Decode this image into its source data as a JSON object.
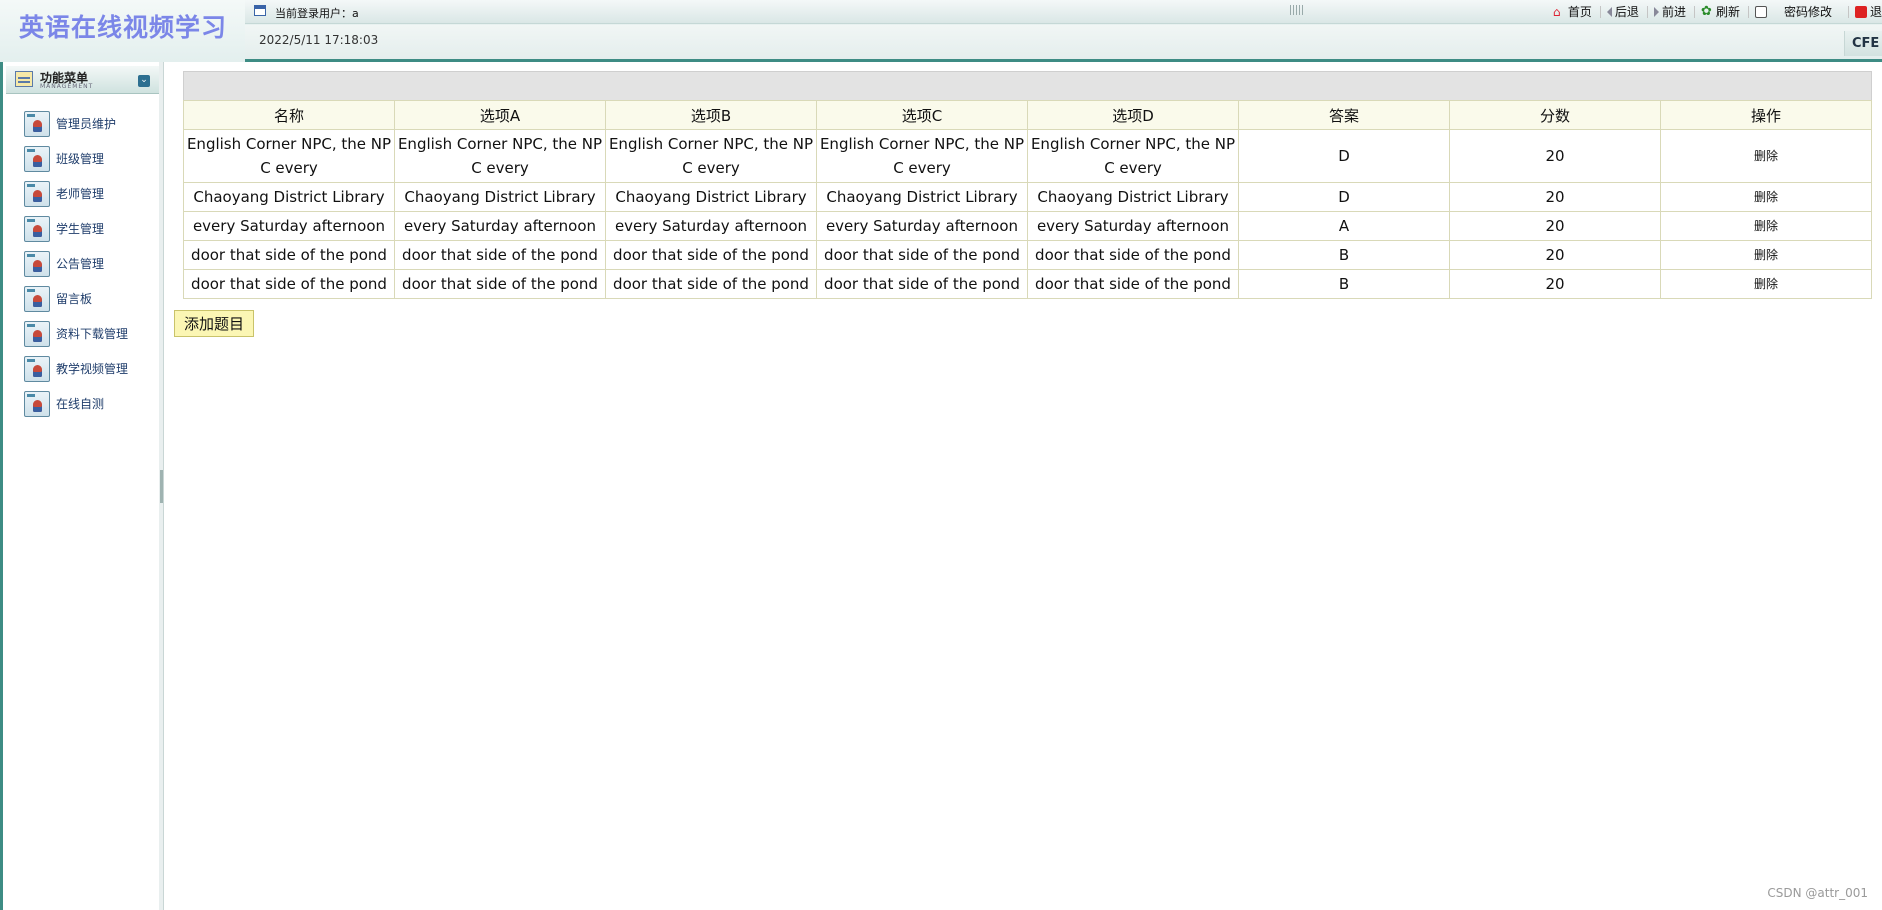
{
  "app": {
    "logo": "英语在线视频学习"
  },
  "header": {
    "current_user": "当前登录用户：a",
    "datetime": "2022/5/11 17:18:03",
    "corner_text": "CFE",
    "tools": [
      {
        "label": "首页",
        "icon": "home-icon"
      },
      {
        "label": "后退",
        "icon": "back-arrow-icon"
      },
      {
        "label": "前进",
        "icon": "forward-arrow-icon"
      },
      {
        "label": "刷新",
        "icon": "refresh-icon"
      },
      {
        "label": "密码修改",
        "icon": "edit-password-icon"
      },
      {
        "label": "退",
        "icon": "exit-icon"
      }
    ]
  },
  "sidebar": {
    "title": "功能菜单",
    "subtitle": "MANAGEMENT",
    "items": [
      {
        "label": "管理员维护",
        "icon": "user-card-icon"
      },
      {
        "label": "班级管理",
        "icon": "user-card-icon"
      },
      {
        "label": "老师管理",
        "icon": "user-card-icon"
      },
      {
        "label": "学生管理",
        "icon": "user-card-icon"
      },
      {
        "label": "公告管理",
        "icon": "user-card-icon"
      },
      {
        "label": "留言板",
        "icon": "user-card-icon"
      },
      {
        "label": "资料下载管理",
        "icon": "user-card-icon"
      },
      {
        "label": "教学视频管理",
        "icon": "user-card-icon"
      },
      {
        "label": "在线自测",
        "icon": "user-card-icon"
      }
    ]
  },
  "table": {
    "columns": [
      "名称",
      "选项A",
      "选项B",
      "选项C",
      "选项D",
      "答案",
      "分数",
      "操作"
    ],
    "rows": [
      [
        "English Corner NPC, the NPC every",
        "English Corner NPC, the NPC every",
        "English Corner NPC, the NPC every",
        "English Corner NPC, the NPC every",
        "English Corner NPC, the NPC every",
        "D",
        "20",
        "删除"
      ],
      [
        "Chaoyang District Library",
        "Chaoyang District Library",
        "Chaoyang District Library",
        "Chaoyang District Library",
        "Chaoyang District Library",
        "D",
        "20",
        "删除"
      ],
      [
        "every Saturday afternoon",
        "every Saturday afternoon",
        "every Saturday afternoon",
        "every Saturday afternoon",
        "every Saturday afternoon",
        "A",
        "20",
        "删除"
      ],
      [
        "door that side of the pond",
        "door that side of the pond",
        "door that side of the pond",
        "door that side of the pond",
        "door that side of the pond",
        "B",
        "20",
        "删除"
      ],
      [
        "door that side of the pond",
        "door that side of the pond",
        "door that side of the pond",
        "door that side of the pond",
        "door that side of the pond",
        "B",
        "20",
        "删除"
      ]
    ]
  },
  "add_button": "添加题目",
  "watermark": "CSDN @attr_001",
  "colors": {
    "accent": "#3d8c84",
    "logo": "#7b86e8",
    "menu_text": "#1f3d6b",
    "header_bg": "#fafaeb",
    "button_bg": "#fbf6b4"
  }
}
